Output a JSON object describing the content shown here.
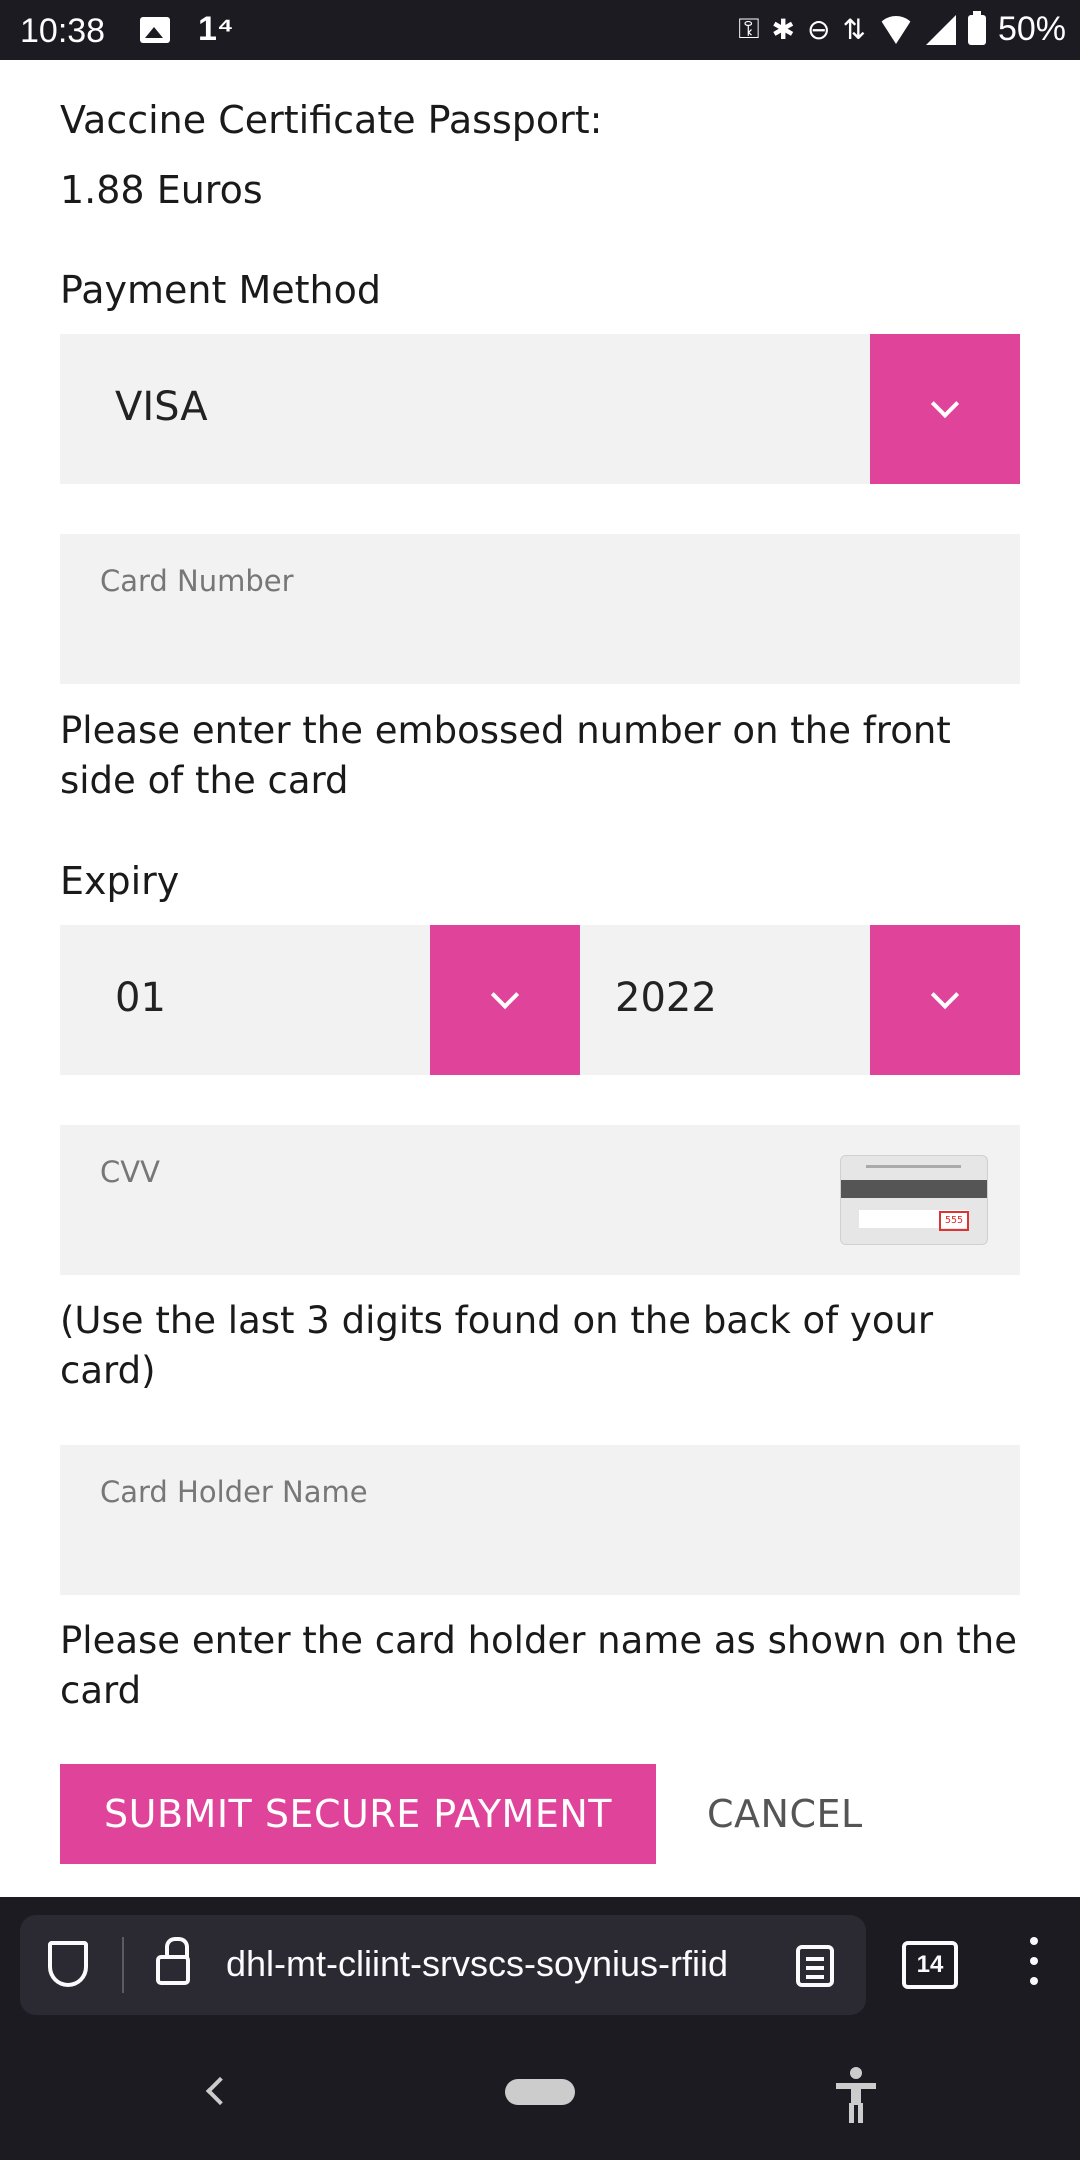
{
  "status_bar": {
    "time": "10:38",
    "network": "1⁴",
    "battery": "50%"
  },
  "form": {
    "product_label": "Vaccine Certificate Passport:",
    "price": "1.88 Euros",
    "payment_method_label": "Payment Method",
    "payment_method_value": "VISA",
    "card_number_placeholder": "Card Number",
    "card_number_help": "Please enter the embossed number on the front side of the card",
    "expiry_label": "Expiry",
    "expiry_month": "01",
    "expiry_year": "2022",
    "cvv_placeholder": "CVV",
    "cvv_card_code": "555",
    "cvv_help": "(Use the last 3 digits found on the back of your card)",
    "holder_placeholder": "Card Holder Name",
    "holder_help": "Please enter the card holder name as shown on the card",
    "submit_label": "SUBMIT SECURE PAYMENT",
    "cancel_label": "CANCEL"
  },
  "browser": {
    "url": "dhl-mt-cliint-srvscs-soynius-rfiid",
    "tab_count": "14"
  },
  "colors": {
    "accent": "#e0439a",
    "field_bg": "#f2f2f2",
    "chrome_bg": "#1c1b22"
  }
}
